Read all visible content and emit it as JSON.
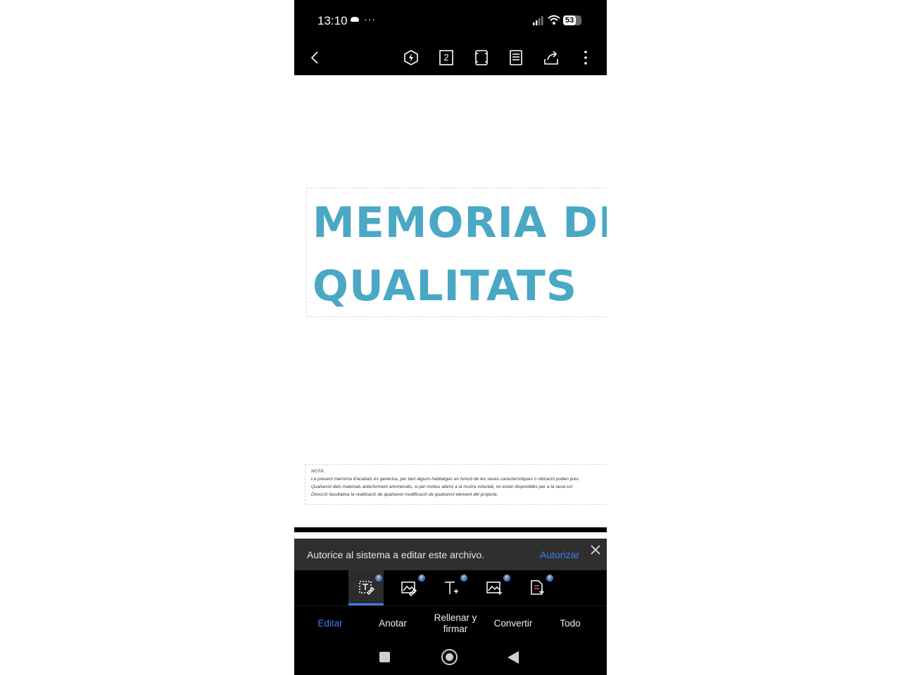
{
  "status_bar": {
    "time": "13:10",
    "more": "···",
    "battery": "53"
  },
  "toolbar": {
    "page_number": "2"
  },
  "document": {
    "title_line1": "MEMORIA DE",
    "title_line2": "QUALITATS",
    "note_label": "NOTA:",
    "note_lines": [
      "La present memòria d'acabats és genèrica, per tant alguns habitatges en funció de les seves característiques o ubicació poden pres",
      "Qualsevol dels materials anteriorment anomenats, si per motius aliens a la nostra voluntat, no estan disponibles per a la seva col",
      "Direcció facultativa la realització de qualsevol modificació de qualsevol element del projecte."
    ]
  },
  "banner": {
    "text": "Autorice al sistema a editar este archivo.",
    "action": "Autorizar"
  },
  "tabs": [
    "Editar",
    "Anotar",
    "Rellenar y firmar",
    "Convertir",
    "Todo"
  ],
  "active_tab": "Editar",
  "accent_color": "#3b7ff0",
  "title_color": "#4aa8c4"
}
